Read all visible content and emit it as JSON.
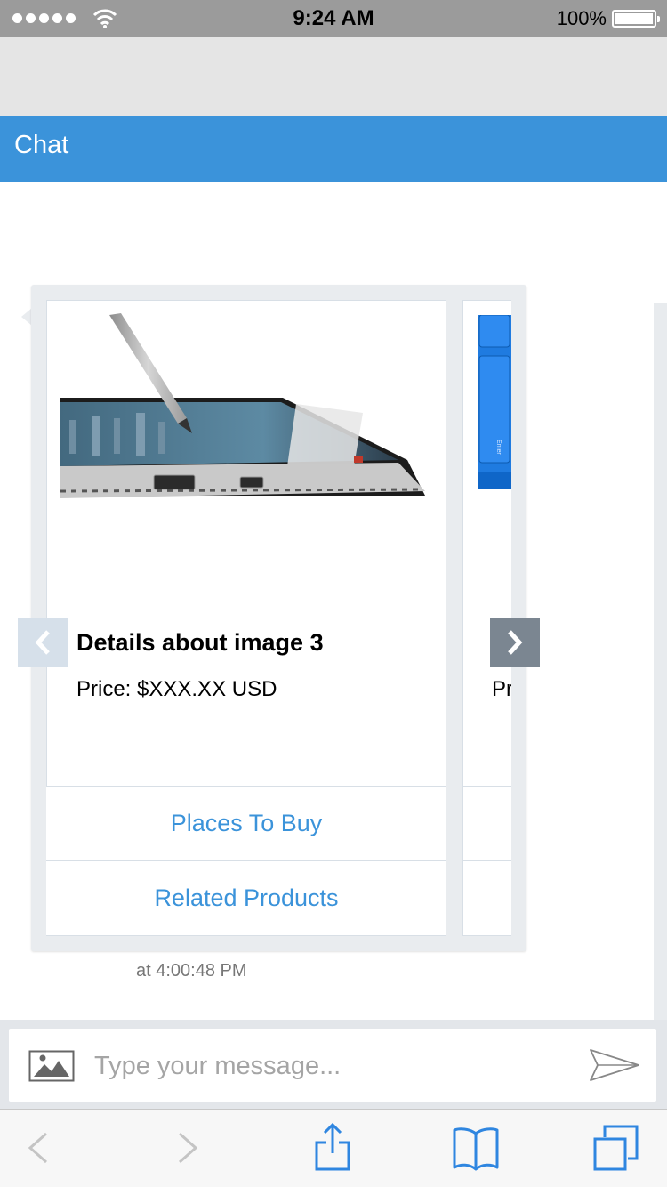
{
  "status_bar": {
    "time": "9:24 AM",
    "battery_percent": "100%",
    "signal_bars": 5,
    "icons": [
      "signal-dots-icon",
      "wifi-icon",
      "battery-icon"
    ]
  },
  "header": {
    "title": "Chat"
  },
  "carousel": {
    "cards": [
      {
        "title": "Details about image 3",
        "price": "Price: $XXX.XX USD",
        "image": "tablet-with-stylus-image",
        "buttons": [
          {
            "label": "Places To Buy"
          },
          {
            "label": "Related Products"
          }
        ]
      },
      {
        "price_visible_fragment": "Pr",
        "image": "blue-keyboard-image",
        "keyboard_key_label": "Enter"
      }
    ],
    "prev_icon": "chevron-left-icon",
    "next_icon": "chevron-right-icon"
  },
  "message": {
    "timestamp": "at 4:00:48 PM"
  },
  "composer": {
    "placeholder": "Type your message...",
    "image_icon": "image-icon",
    "send_icon": "send-icon"
  },
  "toolbar": {
    "icons": [
      "back-icon",
      "forward-icon",
      "share-icon",
      "bookmarks-icon",
      "tabs-icon"
    ]
  },
  "colors": {
    "status_bar": "#9b9b9b",
    "header": "#3b93da",
    "link": "#3b93da",
    "bubble": "#e9ecef",
    "toolbar_icons": "#2f86e0"
  }
}
